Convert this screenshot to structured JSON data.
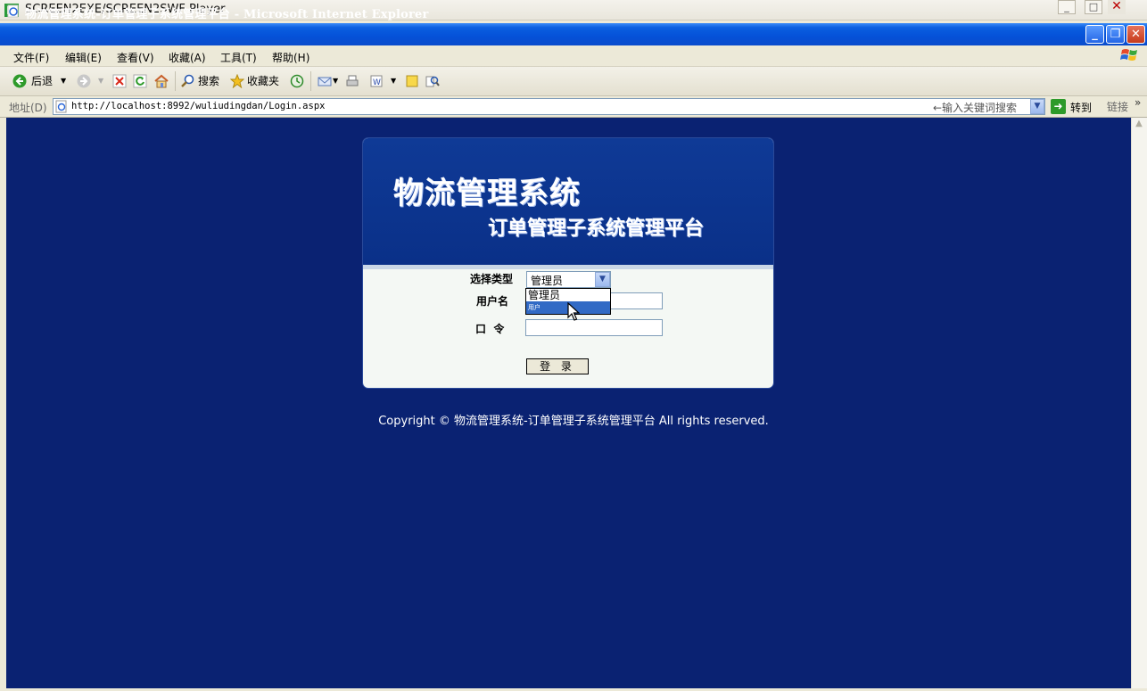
{
  "player": {
    "title": "SCREEN2EXE/SCREEN2SWF Player"
  },
  "browser": {
    "title": "物流管理系统-订单管理子系统管理平台 - Microsoft Internet Explorer",
    "menu": [
      "文件(F)",
      "编辑(E)",
      "查看(V)",
      "收藏(A)",
      "工具(T)",
      "帮助(H)"
    ],
    "toolbar": {
      "back": "后退",
      "search": "搜索",
      "favorites": "收藏夹"
    },
    "address": {
      "label": "地址(D)",
      "url": "http://localhost:8992/wuliudingdan/Login.aspx",
      "search_hint": "←输入关键词搜索",
      "go": "转到",
      "links": "链接"
    }
  },
  "login": {
    "system_title": "物流管理系统",
    "system_subtitle": "订单管理子系统管理平台",
    "type_label": "选择类型",
    "type_selected": "管理员",
    "type_options": [
      "管理员",
      "用户"
    ],
    "username_label": "用户名",
    "password_label": "口  令",
    "submit_label": "登 录"
  },
  "footer": {
    "copyright": "Copyright © 物流管理系统-订单管理子系统管理平台 All rights reserved."
  },
  "colors": {
    "page_bg": "#0a2272",
    "panel_header": "#0c3590",
    "selection": "#316ac5"
  }
}
